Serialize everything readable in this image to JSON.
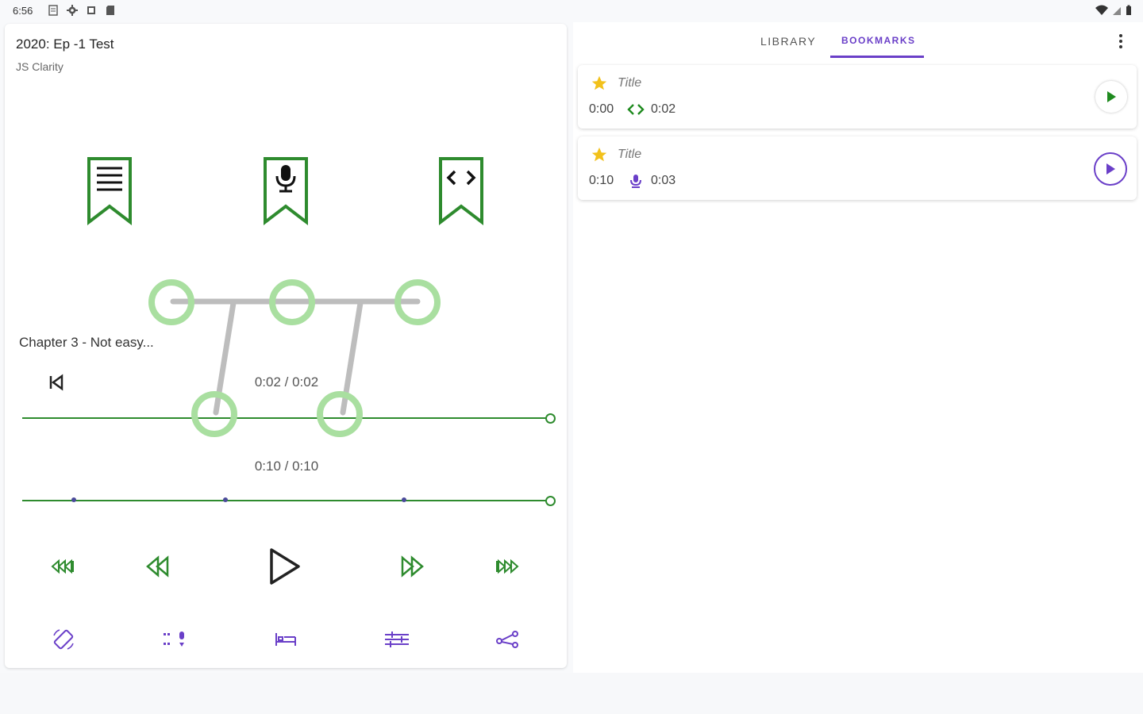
{
  "status_bar": {
    "time": "6:56"
  },
  "episode": {
    "title": "2020: Ep -1 Test",
    "author": "JS Clarity"
  },
  "player": {
    "chapter": "Chapter 3 - Not easy...",
    "chapter_time": "0:02 / 0:02",
    "total_time": "0:10 / 0:10",
    "chapter_progress": 1.0,
    "total_progress": 1.0
  },
  "tabs": {
    "library": "LIBRARY",
    "bookmarks": "BOOKMARKS",
    "active": "bookmarks"
  },
  "bookmarks": [
    {
      "title": "Title",
      "start": "0:00",
      "kind": "code-icon",
      "duration": "0:02",
      "play_color": "#1e8a1e"
    },
    {
      "title": "Title",
      "start": "0:10",
      "kind": "mic-icon",
      "duration": "0:03",
      "play_color": "#6a3fc8"
    }
  ],
  "colors": {
    "accent_green": "#2e8b2e",
    "accent_purple": "#6a3fc8",
    "star": "#f2c11b",
    "overlay": "#a9dfa0"
  }
}
